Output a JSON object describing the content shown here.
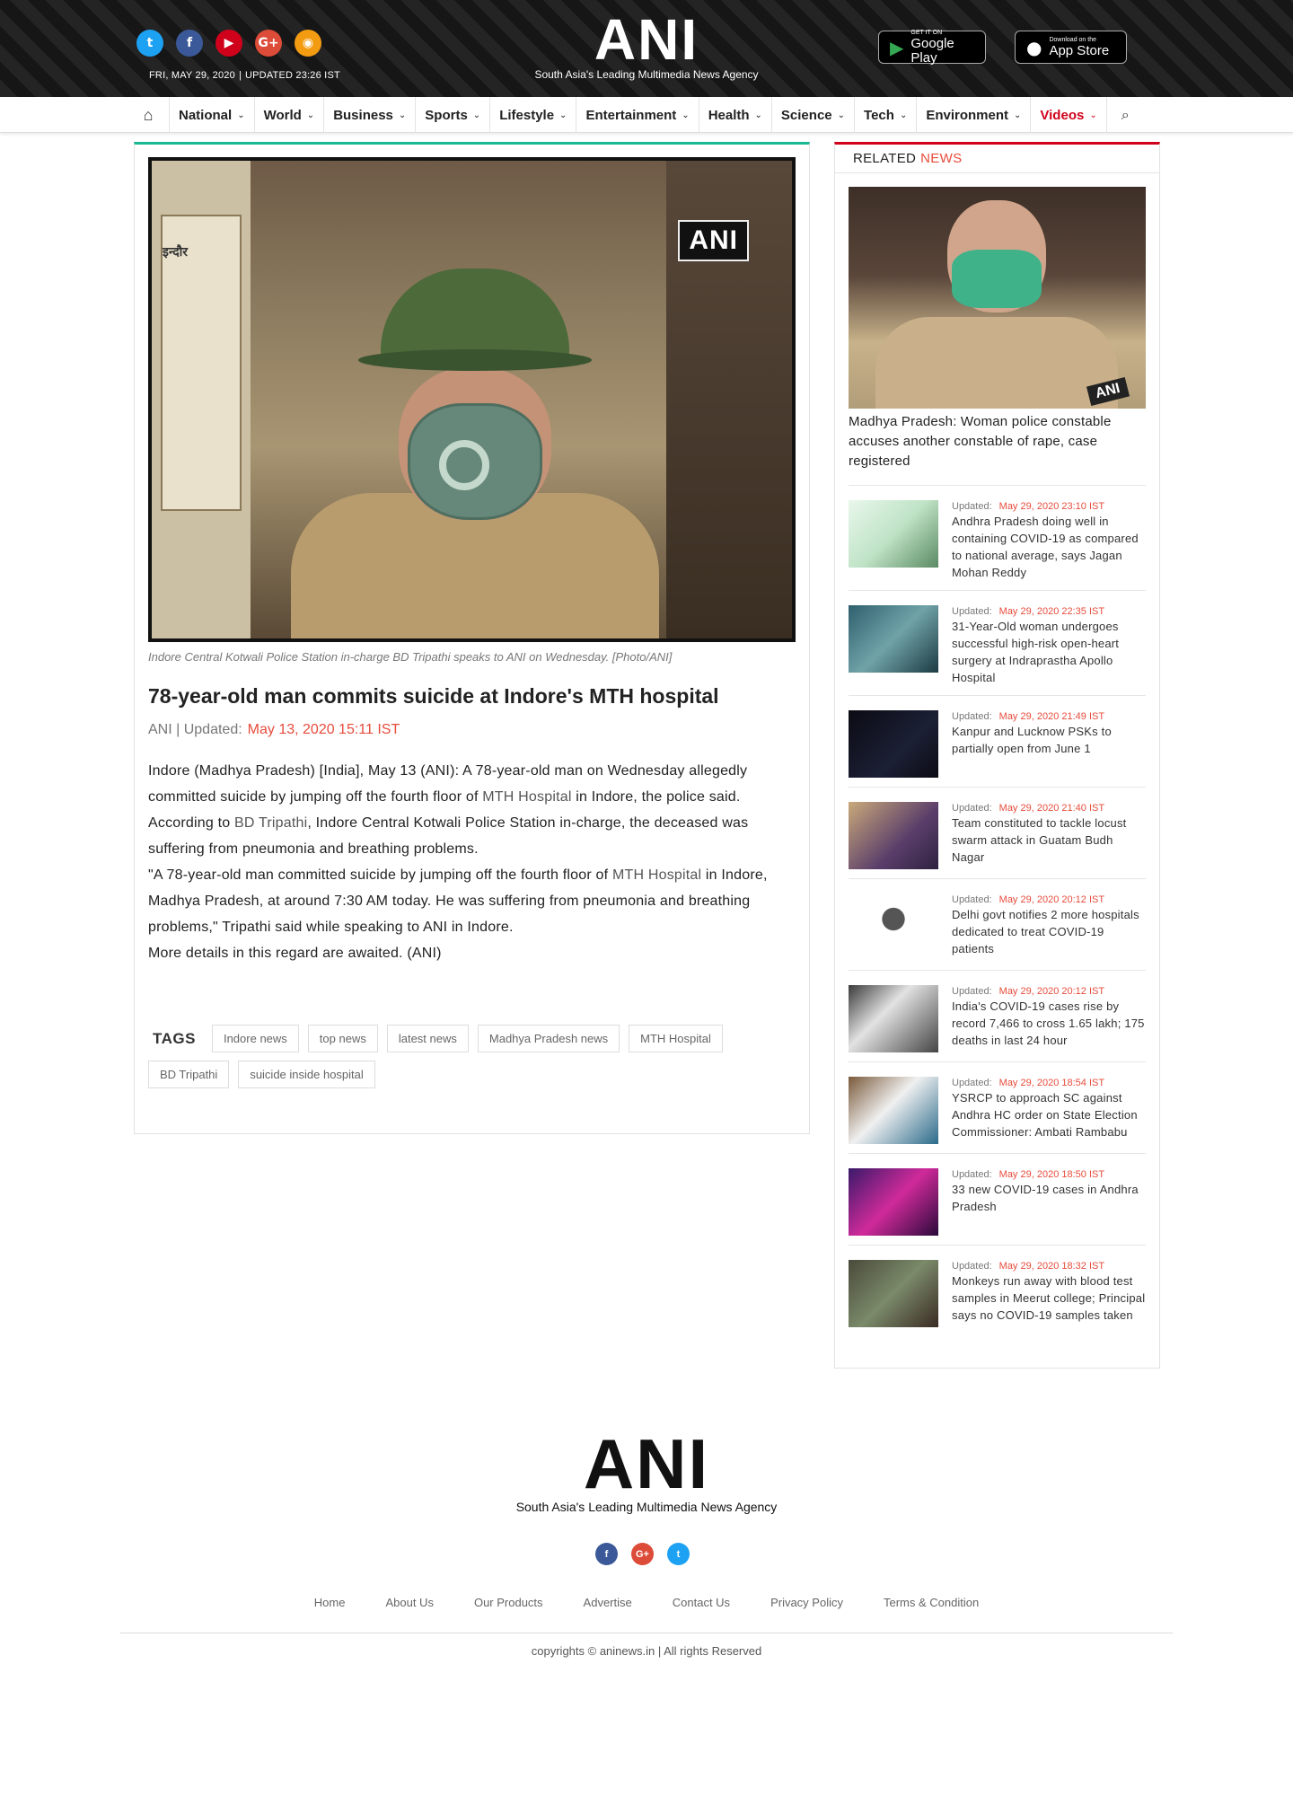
{
  "header": {
    "dateline": {
      "date": "FRI, MAY 29, 2020",
      "updated": "UPDATED 23:26 IST"
    },
    "logo": {
      "word": "ANI",
      "tagline": "South Asia's Leading Multimedia News Agency"
    },
    "social": [
      {
        "name": "twitter-icon",
        "glyph": "t",
        "color": "#1da1f2"
      },
      {
        "name": "facebook-icon",
        "glyph": "f",
        "color": "#3b5998"
      },
      {
        "name": "youtube-icon",
        "glyph": "▶",
        "color": "#d0021b"
      },
      {
        "name": "google-plus-icon",
        "glyph": "G+",
        "color": "#dd4b39"
      },
      {
        "name": "rss-icon",
        "glyph": "◉",
        "color": "#f39c12"
      }
    ],
    "stores": {
      "google": {
        "small": "GET IT ON",
        "big": "Google Play"
      },
      "apple": {
        "small": "Download on the",
        "big": "App Store"
      }
    }
  },
  "nav": {
    "items": [
      "National",
      "World",
      "Business",
      "Sports",
      "Lifestyle",
      "Entertainment",
      "Health",
      "Science",
      "Tech",
      "Environment",
      "Videos"
    ]
  },
  "article": {
    "image_bug": "ANI",
    "caption": "Indore Central Kotwali Police Station in-charge BD Tripathi speaks to ANI on Wednesday. [Photo/ANI]",
    "title": "78-year-old man commits suicide at Indore's MTH hospital",
    "byline": {
      "source": "ANI | Updated:",
      "date": "May 13, 2020 15:11 IST"
    },
    "paragraphs": {
      "p1a": "Indore (Madhya Pradesh) [India], May 13 (ANI): A 78-year-old man on Wednesday allegedly committed suicide by jumping off the fourth floor of ",
      "p1link": "MTH Hospital",
      "p1b": " in Indore, the police said.",
      "p2a": "According to ",
      "p2link": "BD Tripathi",
      "p2b": ", Indore Central Kotwali Police Station in-charge, the deceased was suffering from pneumonia and breathing problems.",
      "p3a": "\"A 78-year-old man committed suicide by jumping off the fourth floor of ",
      "p3link": "MTH Hospital",
      "p3b": " in Indore, Madhya Pradesh, at around 7:30 AM today. He was suffering from pneumonia and breathing problems,\" Tripathi said while speaking to ANI in Indore.",
      "p4": "More details in this regard are awaited. (ANI)"
    },
    "tags_label": "TAGS",
    "tags": [
      "Indore news",
      "top news",
      "latest news",
      "Madhya Pradesh news",
      "MTH Hospital",
      "BD Tripathi",
      "suicide inside hospital"
    ]
  },
  "sidebar": {
    "heading": "RELATED",
    "heading_accent": "NEWS",
    "featured": {
      "title": "Madhya Pradesh: Woman police constable accuses another constable of rape, case registered",
      "image_bug": "ANI"
    },
    "updated_label": "Updated:",
    "items": [
      {
        "date": "May 29, 2020 23:10 IST",
        "title": "Andhra Pradesh doing well in containing COVID-19 as compared to national average, says Jagan Mohan Reddy",
        "thumb": "linear-gradient(135deg,#e9f7ec,#bfe3c6 50%,#5a8a62)"
      },
      {
        "date": "May 29, 2020 22:35 IST",
        "title": "31-Year-Old woman undergoes successful high-risk open-heart surgery at Indraprastha Apollo Hospital",
        "thumb": "linear-gradient(135deg,#2f5f6e,#6fa3a8 50%,#1c3a42)"
      },
      {
        "date": "May 29, 2020 21:49 IST",
        "title": "Kanpur and Lucknow PSKs to partially open from June 1",
        "thumb": "linear-gradient(135deg,#0b0b14,#1c2035 60%,#0b0b14)"
      },
      {
        "date": "May 29, 2020 21:40 IST",
        "title": "Team constituted to tackle locust swarm attack in Guatam Budh Nagar",
        "thumb": "linear-gradient(135deg,#c9a97a,#5a3e6a 60%,#2e2140)"
      },
      {
        "date": "May 29, 2020 20:12 IST",
        "title": "Delhi govt notifies 2 more hospitals dedicated to treat COVID-19 patients",
        "thumb": "radial-gradient(circle at 50% 38%,#555 0 18%,#fff 19%)"
      },
      {
        "date": "May 29, 2020 20:12 IST",
        "title": "India's COVID-19 cases rise by record 7,466 to cross 1.65 lakh; 175 deaths in last 24 hour",
        "thumb": "linear-gradient(135deg,#3a3a3a,#e2e2e2 40%,#444)"
      },
      {
        "date": "May 29, 2020 18:54 IST",
        "title": "YSRCP to approach SC against Andhra HC order on State Election Commissioner: Ambati Rambabu",
        "thumb": "linear-gradient(135deg,#7a5a3a,#f0f0f0 45%,#2a6a8a)"
      },
      {
        "date": "May 29, 2020 18:50 IST",
        "title": "33 new COVID-19 cases in Andhra Pradesh",
        "thumb": "linear-gradient(135deg,#3a1a6a,#d02a9a 50%,#2a0a3a)"
      },
      {
        "date": "May 29, 2020 18:32 IST",
        "title": "Monkeys run away with blood test samples in Meerut college; Principal says no COVID-19 samples taken",
        "thumb": "linear-gradient(135deg,#4a4a3a,#7a8a6a 50%,#3a2a22)"
      }
    ]
  },
  "footer": {
    "logo": {
      "word": "ANI",
      "tagline": "South Asia's Leading Multimedia News Agency"
    },
    "social": [
      {
        "name": "facebook-icon",
        "glyph": "f",
        "color": "#3b5998"
      },
      {
        "name": "google-plus-icon",
        "glyph": "G+",
        "color": "#dd4b39"
      },
      {
        "name": "twitter-icon",
        "glyph": "t",
        "color": "#1da1f2"
      }
    ],
    "links": [
      "Home",
      "About Us",
      "Our Products",
      "Advertise",
      "Contact Us",
      "Privacy Policy",
      "Terms & Condition"
    ],
    "copyright": "copyrights © aninews.in | All rights Reserved"
  }
}
